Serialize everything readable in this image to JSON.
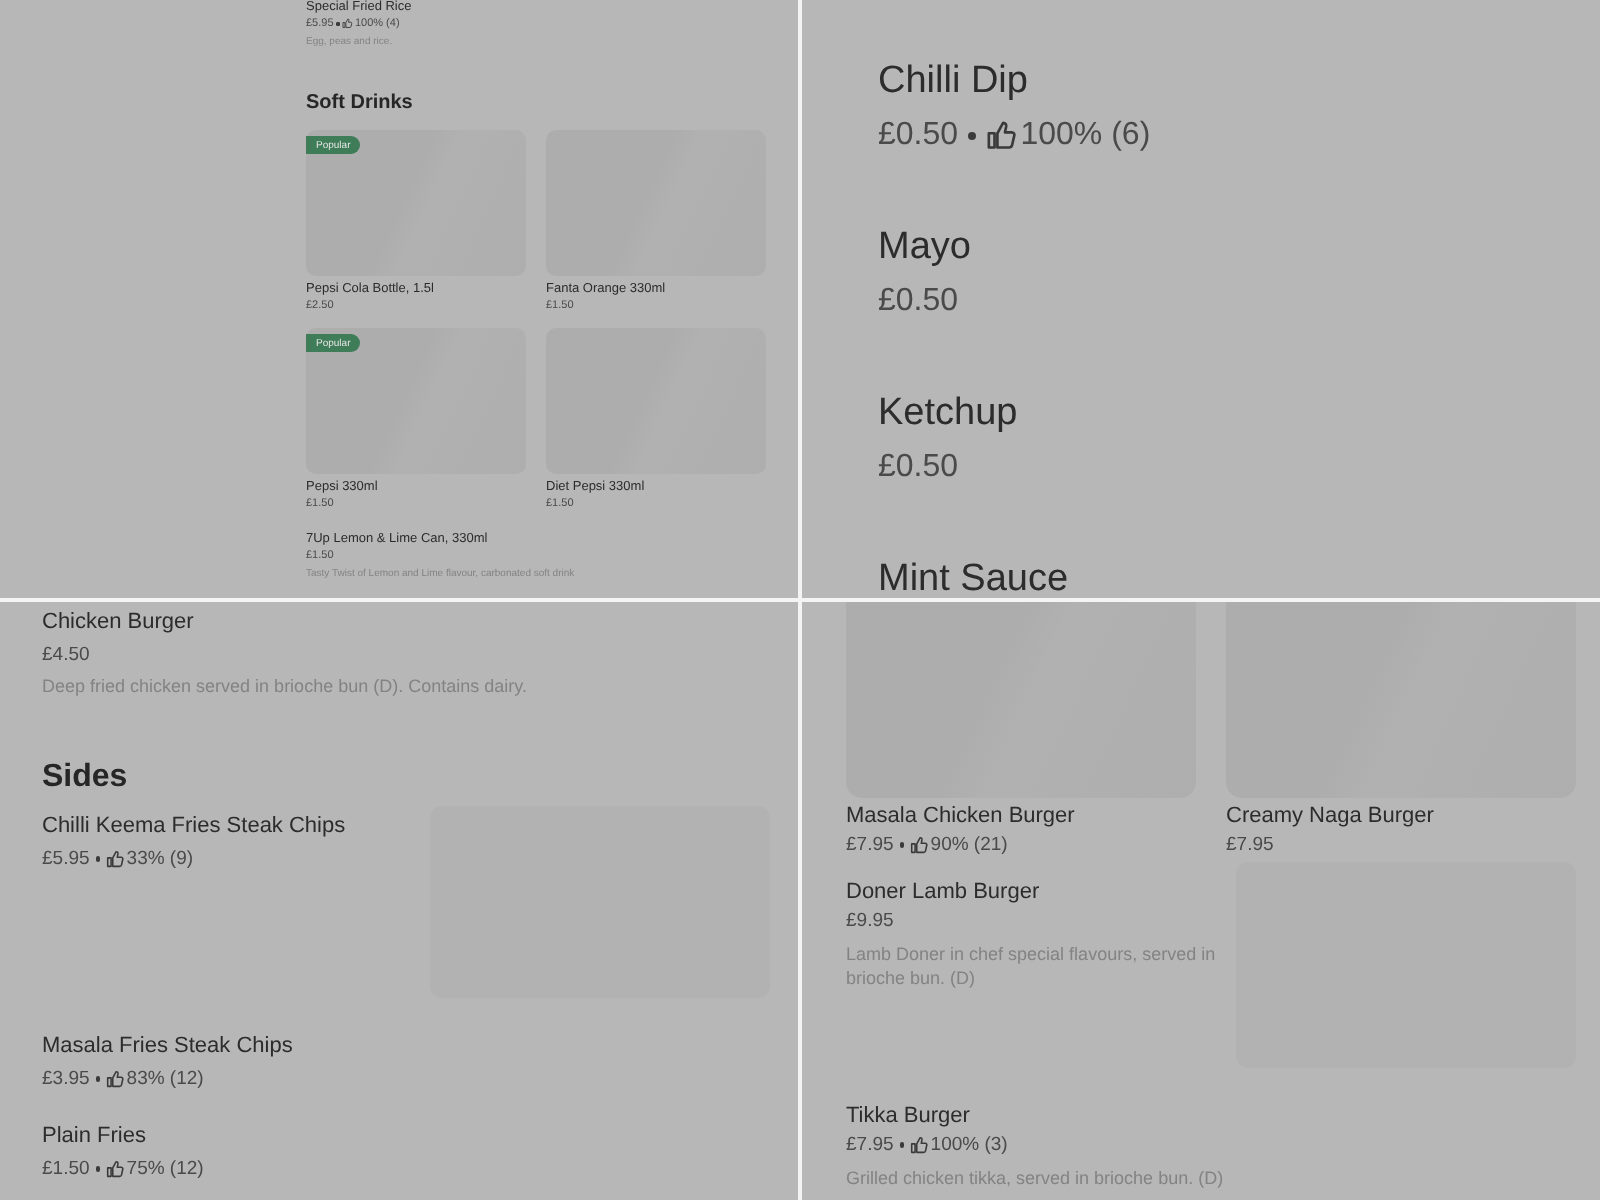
{
  "panels": [
    {
      "kind": "drinks",
      "top_item": {
        "name": "Special Fried Rice",
        "price": "£5.95",
        "rating": "100% (4)",
        "description": "Egg, peas and rice."
      },
      "section": "Soft Drinks",
      "cards": [
        {
          "name": "Pepsi Cola Bottle, 1.5l",
          "price": "£2.50",
          "badge": "Popular"
        },
        {
          "name": "Fanta Orange 330ml",
          "price": "£1.50"
        },
        {
          "name": "Pepsi 330ml",
          "price": "£1.50",
          "badge": "Popular"
        },
        {
          "name": "Diet Pepsi 330ml",
          "price": "£1.50"
        }
      ],
      "items": [
        {
          "name": "7Up Lemon & Lime Can, 330ml",
          "price": "£1.50",
          "description": "Tasty Twist of Lemon and Lime flavour, carbonated soft drink"
        }
      ]
    },
    {
      "kind": "dips",
      "items": [
        {
          "name": "Chilli Dip",
          "price": "£0.50",
          "rating": "100% (6)"
        },
        {
          "name": "Mayo",
          "price": "£0.50"
        },
        {
          "name": "Ketchup",
          "price": "£0.50"
        },
        {
          "name": "Mint Sauce"
        }
      ]
    },
    {
      "kind": "sides",
      "top_item": {
        "name": "Chicken Burger",
        "price": "£4.50",
        "description": "Deep fried chicken served in brioche bun (D). Contains dairy."
      },
      "section": "Sides",
      "items": [
        {
          "name": "Chilli Keema Fries Steak Chips",
          "price": "£5.95",
          "rating": "33% (9)",
          "image": true
        },
        {
          "name": "Masala Fries Steak Chips",
          "price": "£3.95",
          "rating": "83% (12)",
          "image": false
        },
        {
          "name": "Plain Fries",
          "price": "£1.50",
          "rating": "75% (12)",
          "image": false
        }
      ]
    },
    {
      "kind": "burgers",
      "cards": [
        {
          "name": "Masala Chicken Burger",
          "price": "£7.95",
          "rating": "90% (21)"
        },
        {
          "name": "Creamy Naga Burger",
          "price": "£7.95"
        }
      ],
      "items": [
        {
          "name": "Doner Lamb Burger",
          "price": "£9.95",
          "description": "Lamb Doner in chef special flavours, served in brioche bun. (D)",
          "image": true
        },
        {
          "name": "Tikka Burger",
          "price": "£7.95",
          "rating": "100% (3)",
          "description": "Grilled chicken tikka, served in brioche bun. (D)",
          "image": false
        }
      ]
    }
  ]
}
